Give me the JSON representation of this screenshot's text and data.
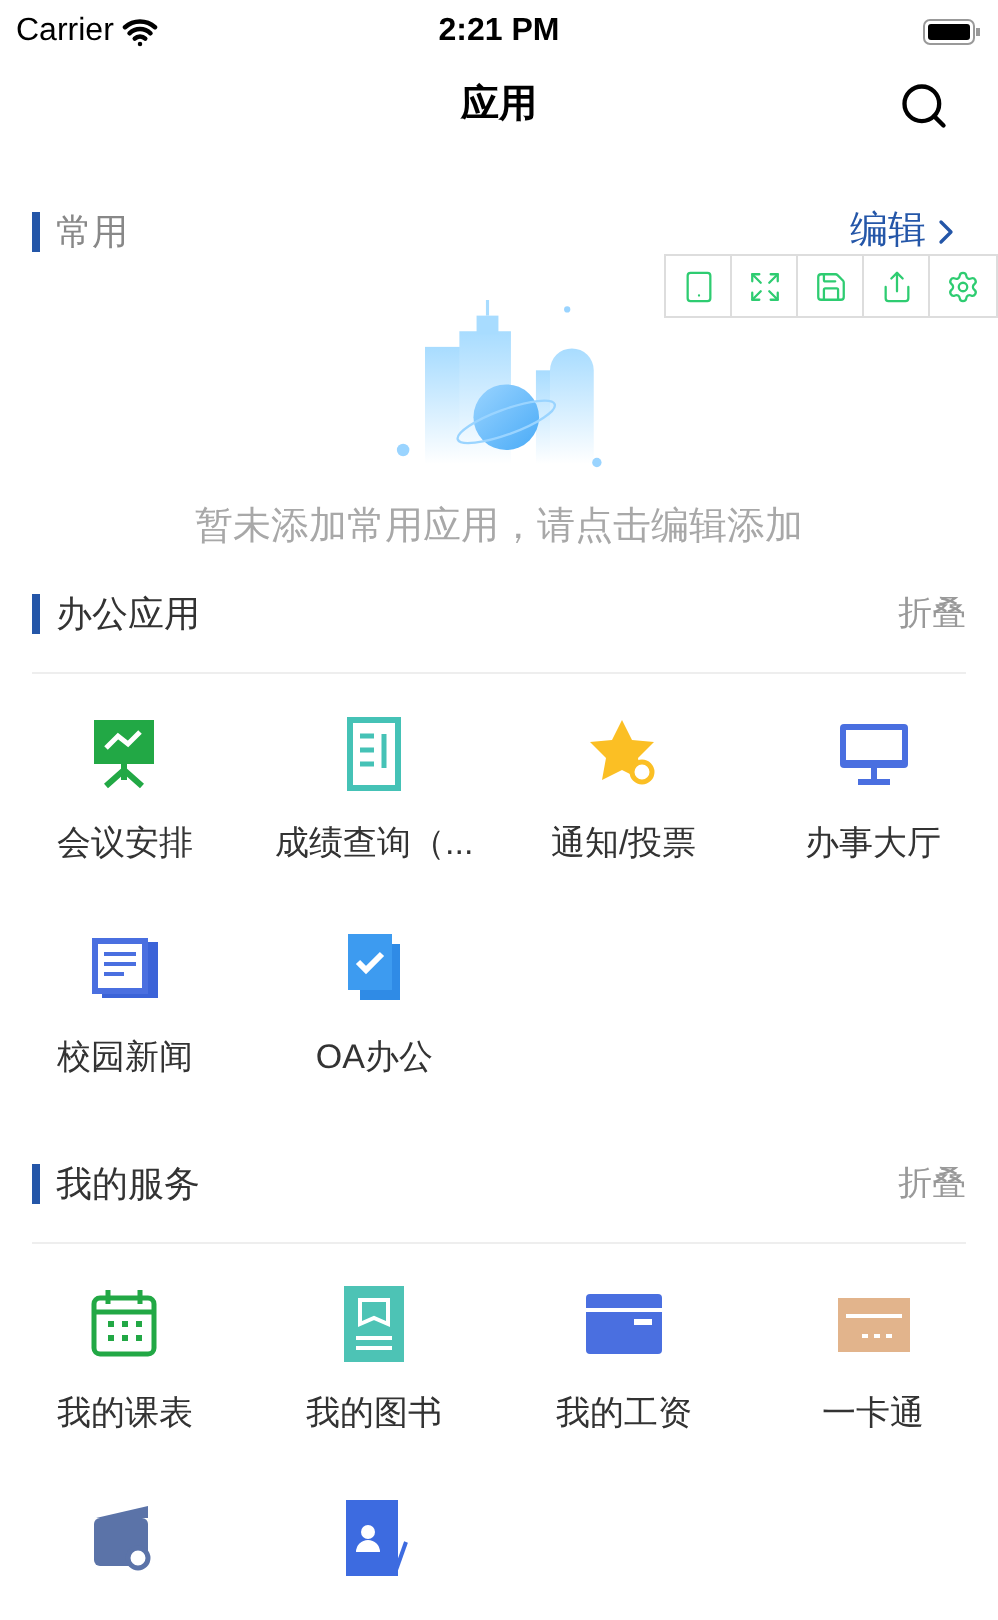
{
  "status_bar": {
    "carrier": "Carrier",
    "time": "2:21 PM"
  },
  "nav": {
    "title": "应用"
  },
  "favorites": {
    "title": "常用",
    "action": "编辑",
    "empty_text": "暂未添加常用应用，请点击编辑添加"
  },
  "toolbar": [
    {
      "kind": "tablet"
    },
    {
      "kind": "expand"
    },
    {
      "kind": "save"
    },
    {
      "kind": "share"
    },
    {
      "kind": "settings"
    }
  ],
  "sections": [
    {
      "title": "办公应用",
      "action": "折叠",
      "items": [
        {
          "kind": "meeting",
          "label": "会议安排"
        },
        {
          "kind": "grades",
          "label": "成绩查询（..."
        },
        {
          "kind": "notice",
          "label": "通知/投票"
        },
        {
          "kind": "hall",
          "label": "办事大厅"
        },
        {
          "kind": "news",
          "label": "校园新闻"
        },
        {
          "kind": "oa",
          "label": "OA办公"
        }
      ]
    },
    {
      "title": "我的服务",
      "action": "折叠",
      "items": [
        {
          "kind": "calendar",
          "label": "我的课表"
        },
        {
          "kind": "book",
          "label": "我的图书"
        },
        {
          "kind": "salary",
          "label": "我的工资"
        },
        {
          "kind": "card",
          "label": "一卡通"
        },
        {
          "kind": "wallet"
        },
        {
          "kind": "profile"
        }
      ]
    }
  ]
}
